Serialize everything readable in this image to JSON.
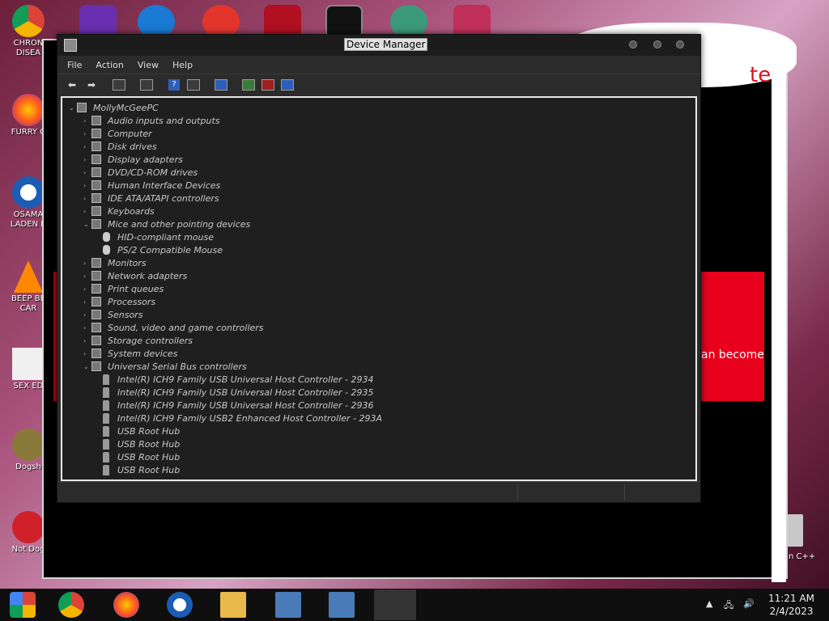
{
  "desktop": {
    "icons": [
      {
        "label": "CHRON DISEA"
      },
      {
        "label": "FURRY C"
      },
      {
        "label": "OSAMA LADEN B"
      },
      {
        "label": "BEEP BE CAR"
      },
      {
        "label": "SEX ED"
      },
      {
        "label": "Dogsh"
      },
      {
        "label": "Not Dog"
      }
    ],
    "right_label": "n C++"
  },
  "background_window": {
    "red_text": "an become",
    "top_text": "te"
  },
  "device_manager": {
    "title": "Device Manager",
    "menu": [
      "File",
      "Action",
      "View",
      "Help"
    ],
    "root": "MollyMcGeePC",
    "tree": [
      {
        "label": "Audio inputs and outputs",
        "level": 1,
        "expanded": false
      },
      {
        "label": "Computer",
        "level": 1,
        "expanded": false
      },
      {
        "label": "Disk drives",
        "level": 1,
        "expanded": false
      },
      {
        "label": "Display adapters",
        "level": 1,
        "expanded": false
      },
      {
        "label": "DVD/CD-ROM drives",
        "level": 1,
        "expanded": false
      },
      {
        "label": "Human Interface Devices",
        "level": 1,
        "expanded": false
      },
      {
        "label": "IDE ATA/ATAPI controllers",
        "level": 1,
        "expanded": false
      },
      {
        "label": "Keyboards",
        "level": 1,
        "expanded": false
      },
      {
        "label": "Mice and other pointing devices",
        "level": 1,
        "expanded": true
      },
      {
        "label": "HID-compliant mouse",
        "level": 2
      },
      {
        "label": "PS/2 Compatible Mouse",
        "level": 2
      },
      {
        "label": "Monitors",
        "level": 1,
        "expanded": false
      },
      {
        "label": "Network adapters",
        "level": 1,
        "expanded": false
      },
      {
        "label": "Print queues",
        "level": 1,
        "expanded": false
      },
      {
        "label": "Processors",
        "level": 1,
        "expanded": false
      },
      {
        "label": "Sensors",
        "level": 1,
        "expanded": false
      },
      {
        "label": "Sound, video and game controllers",
        "level": 1,
        "expanded": false
      },
      {
        "label": "Storage controllers",
        "level": 1,
        "expanded": false
      },
      {
        "label": "System devices",
        "level": 1,
        "expanded": false
      },
      {
        "label": "Universal Serial Bus controllers",
        "level": 1,
        "expanded": true
      },
      {
        "label": "Intel(R) ICH9 Family USB Universal Host Controller - 2934",
        "level": 2
      },
      {
        "label": "Intel(R) ICH9 Family USB Universal Host Controller - 2935",
        "level": 2
      },
      {
        "label": "Intel(R) ICH9 Family USB Universal Host Controller - 2936",
        "level": 2
      },
      {
        "label": "Intel(R) ICH9 Family USB2 Enhanced Host Controller - 293A",
        "level": 2
      },
      {
        "label": "USB Root Hub",
        "level": 2
      },
      {
        "label": "USB Root Hub",
        "level": 2
      },
      {
        "label": "USB Root Hub",
        "level": 2
      },
      {
        "label": "USB Root Hub",
        "level": 2
      }
    ]
  },
  "taskbar": {
    "time": "11:21 AM",
    "date": "2/4/2023"
  }
}
